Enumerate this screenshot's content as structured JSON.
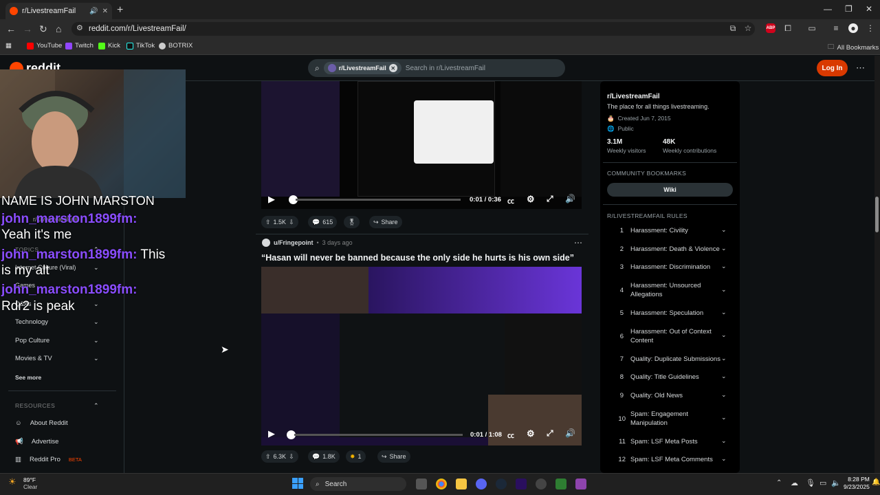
{
  "browser": {
    "tab_title": "r/LivestreamFail",
    "url": "reddit.com/r/LivestreamFail/",
    "bookmarks": [
      "YouTube",
      "Twitch",
      "Kick",
      "TikTok",
      "BOTRIX"
    ],
    "all_bookmarks": "All Bookmarks",
    "ext_badge": "ABP"
  },
  "header": {
    "logo_text": "reddit",
    "search_chip": "r/LivestreamFail",
    "search_placeholder": "Search in r/LivestreamFail",
    "login_label": "Log In"
  },
  "left_sidebar": {
    "topics_header": "TOPICS",
    "topics": [
      "Internet Culture (Viral)",
      "Games",
      "Q&As",
      "Technology",
      "Pop Culture",
      "Movies & TV"
    ],
    "see_more": "See more",
    "resources_header": "RESOURCES",
    "resources": [
      "About Reddit",
      "Advertise",
      "Reddit Pro"
    ],
    "pro_badge": "BETA",
    "partial_item": "r/LivestreamFail"
  },
  "chat_overlay": {
    "top_fragment": "NAME IS JOHN MARSTON",
    "messages": [
      {
        "user": "john_marston1899fm:",
        "text": "Yeah it's me"
      },
      {
        "user": "john_marston1899fm:",
        "text": "This is my alt"
      },
      {
        "user": "john_marston1899fm:",
        "text": "Rdr2 is peak"
      }
    ],
    "msg2_line1": "This",
    "msg2_line2": "is my alt"
  },
  "posts": [
    {
      "time": "0:01 / 0:36",
      "upvotes": "1.5K",
      "comments": "615",
      "share": "Share"
    },
    {
      "author": "u/Fringepoint",
      "age": "3 days ago",
      "title": "“Hasan will never be banned because the only side he hurts is his own side”",
      "time": "0:01 / 1:08",
      "upvotes": "6.3K",
      "comments": "1.8K",
      "awards": "1",
      "share": "Share"
    }
  ],
  "right_sidebar": {
    "name": "r/LivestreamFail",
    "description": "The place for all things livestreaming.",
    "created": "Created Jun 7, 2015",
    "visibility": "Public",
    "stat1_value": "3.1M",
    "stat1_label": "Weekly visitors",
    "stat2_value": "48K",
    "stat2_label": "Weekly contributions",
    "bookmarks_header": "COMMUNITY BOOKMARKS",
    "wiki_label": "Wiki",
    "rules_header": "R/LIVESTREAMFAIL RULES",
    "rules": [
      "Harassment: Civility",
      "Harassment: Death & Violence",
      "Harassment: Discrimination",
      "Harassment: Unsourced Allegations",
      "Harassment: Speculation",
      "Harassment: Out of Context Content",
      "Quality: Duplicate Submissions",
      "Quality: Title Guidelines",
      "Quality: Old News",
      "Spam: Engagement Manipulation",
      "Spam: LSF Meta Posts",
      "Spam: LSF Meta Comments"
    ]
  },
  "taskbar": {
    "weather_temp": "89°F",
    "weather_desc": "Clear",
    "search_label": "Search",
    "time": "8:28 PM",
    "date": "9/23/2025"
  }
}
